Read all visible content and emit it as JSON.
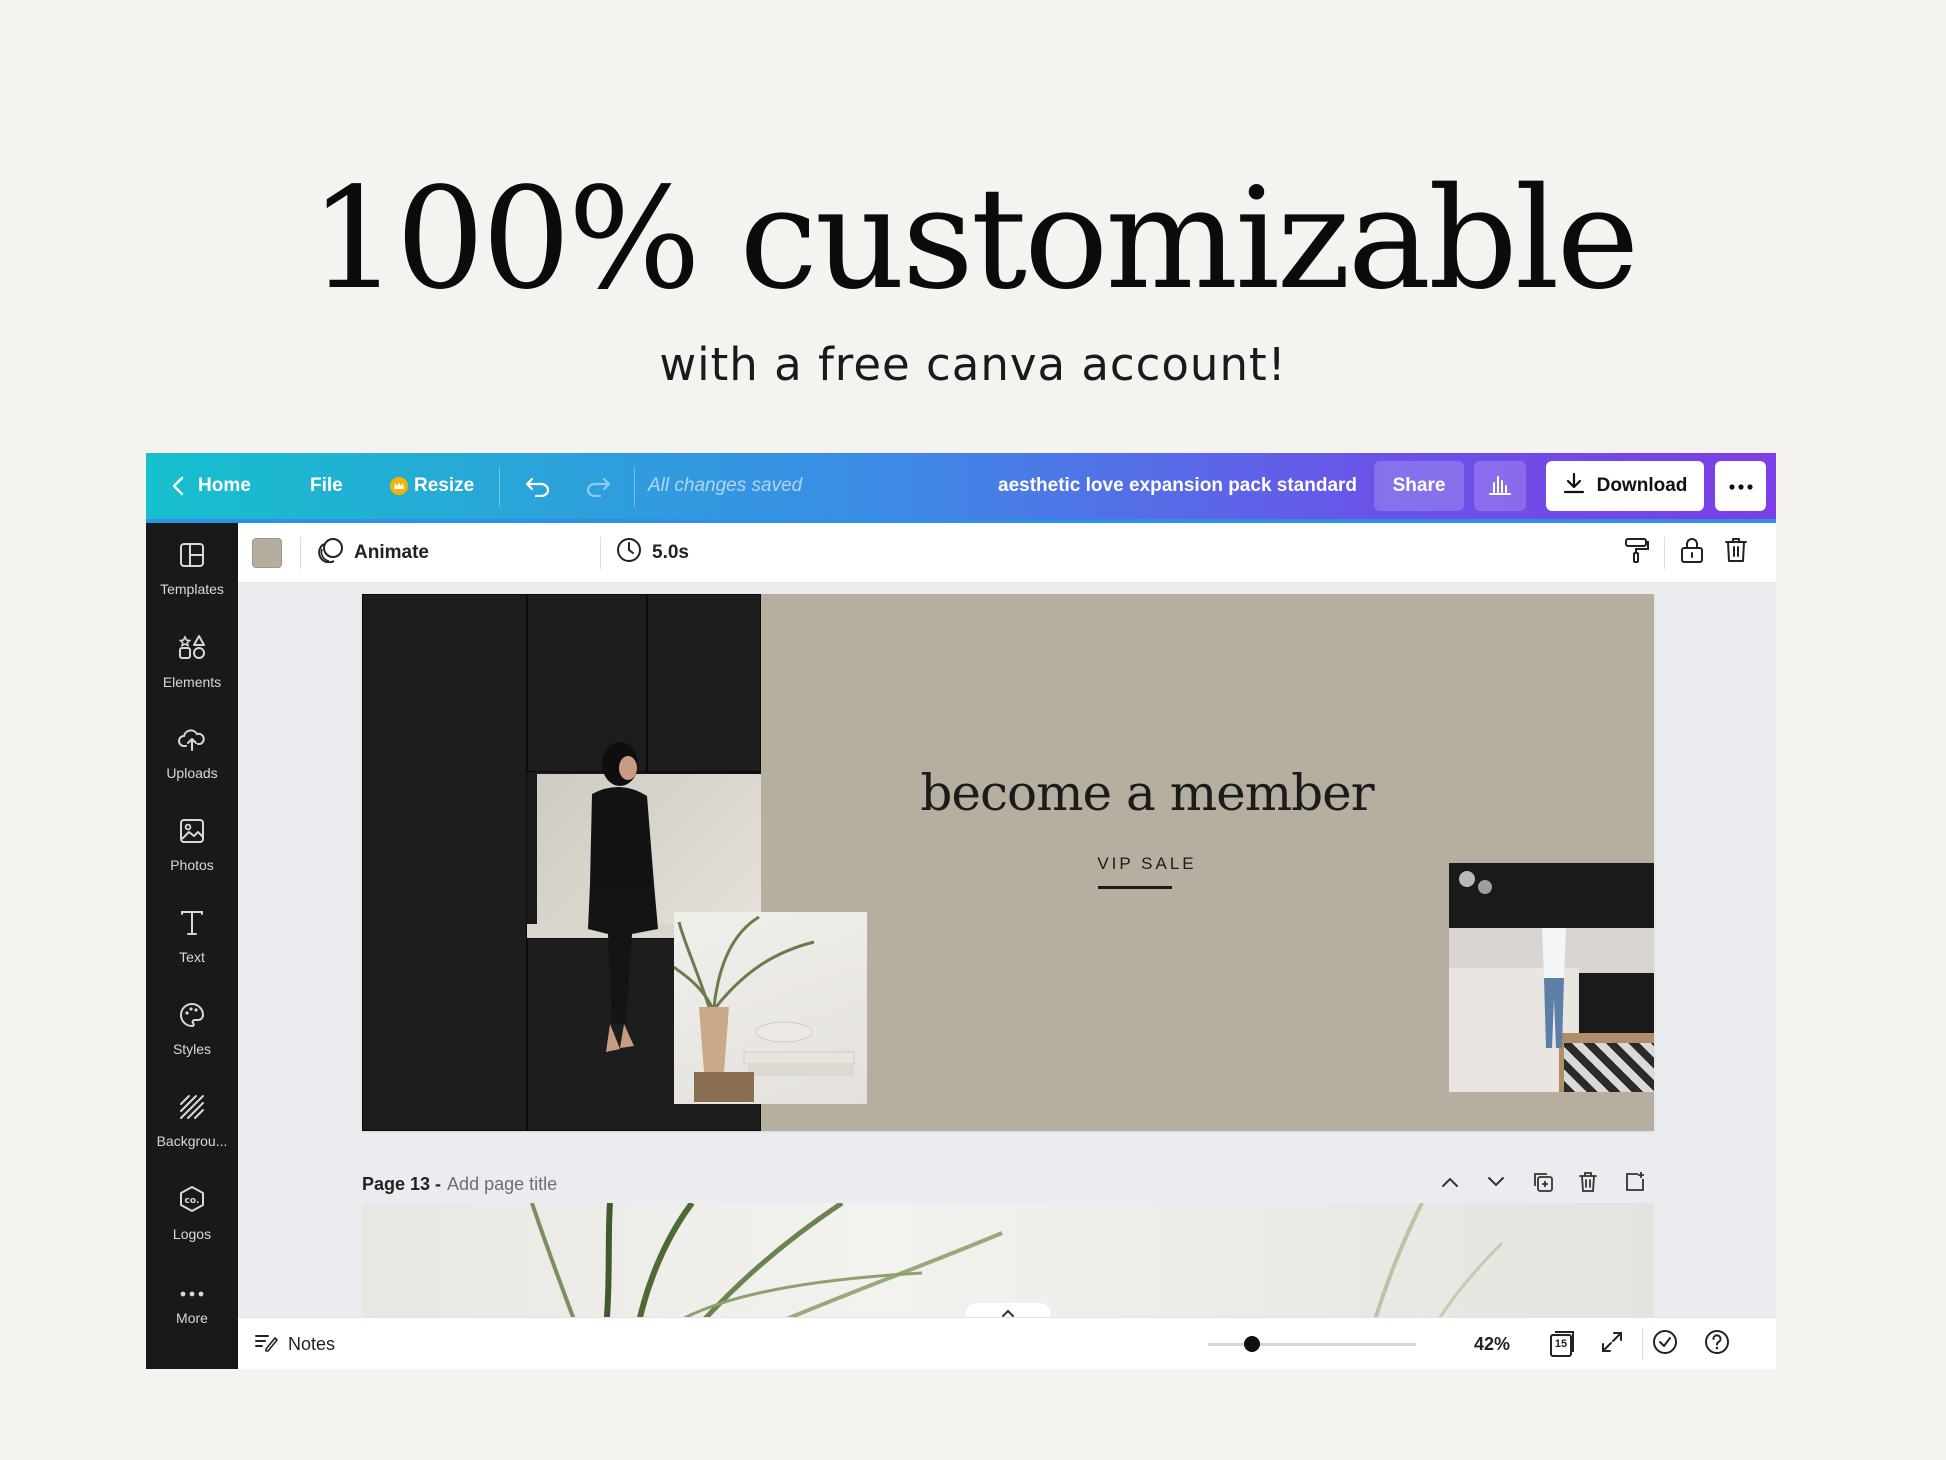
{
  "hero": {
    "title": "100% customizable",
    "subtitle": "with a free canva account!"
  },
  "topbar": {
    "home": "Home",
    "file": "File",
    "resize": "Resize",
    "status": "All changes saved",
    "doc_title": "aesthetic love expansion pack standard",
    "share": "Share",
    "download": "Download",
    "more_icon": "ellipsis-icon"
  },
  "sidebar": {
    "items": [
      {
        "label": "Templates",
        "icon": "templates-icon"
      },
      {
        "label": "Elements",
        "icon": "elements-icon"
      },
      {
        "label": "Uploads",
        "icon": "upload-cloud-icon"
      },
      {
        "label": "Photos",
        "icon": "image-icon"
      },
      {
        "label": "Text",
        "icon": "text-icon"
      },
      {
        "label": "Styles",
        "icon": "palette-icon"
      },
      {
        "label": "Backgrou...",
        "icon": "background-icon"
      },
      {
        "label": "Logos",
        "icon": "logo-icon"
      },
      {
        "label": "More",
        "icon": "ellipsis-icon"
      }
    ]
  },
  "toolbar": {
    "swatch_color": "#b5ad9e",
    "animate": "Animate",
    "duration": "5.0s"
  },
  "canvas": {
    "background": "#b6ae9e",
    "headline": "become a member",
    "cta": "VIP SALE"
  },
  "page13": {
    "label": "Page 13 -",
    "placeholder": "Add page title"
  },
  "bottombar": {
    "notes": "Notes",
    "zoom": "42%",
    "page_count": "15"
  }
}
